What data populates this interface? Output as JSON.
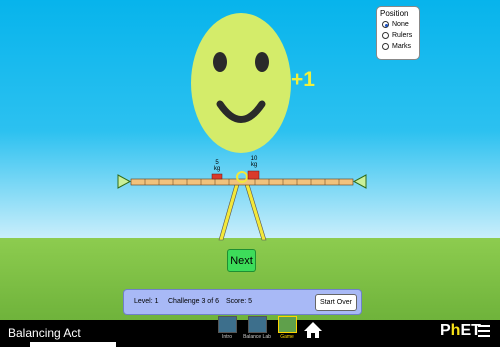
{
  "title": "Balancing Act",
  "position_panel": {
    "title": "Position",
    "options": [
      {
        "label": "None",
        "selected": true
      },
      {
        "label": "Rulers",
        "selected": false
      },
      {
        "label": "Marks",
        "selected": false
      }
    ]
  },
  "feedback": {
    "points_text": "+1",
    "face": "smiley"
  },
  "masses": [
    {
      "label": "5",
      "unit": "kg"
    },
    {
      "label": "10",
      "unit": "kg"
    }
  ],
  "next_label": "Next",
  "status_bar": {
    "level": "Level: 1",
    "challenge": "Challenge 3 of 6",
    "score": "Score: 5",
    "start_over": "Start Over"
  },
  "nav_screens": [
    {
      "label": "Intro",
      "active": false
    },
    {
      "label": "Balance Lab",
      "active": false
    },
    {
      "label": "Game",
      "active": true
    }
  ],
  "brand": {
    "p": "P",
    "h": "h",
    "et": "ET"
  },
  "colors": {
    "sky": "#07b4ec",
    "grass": "#7cc046",
    "face": "#d4ec6a",
    "next_button": "#3ddc5a",
    "status_panel": "#a8b9f6"
  }
}
